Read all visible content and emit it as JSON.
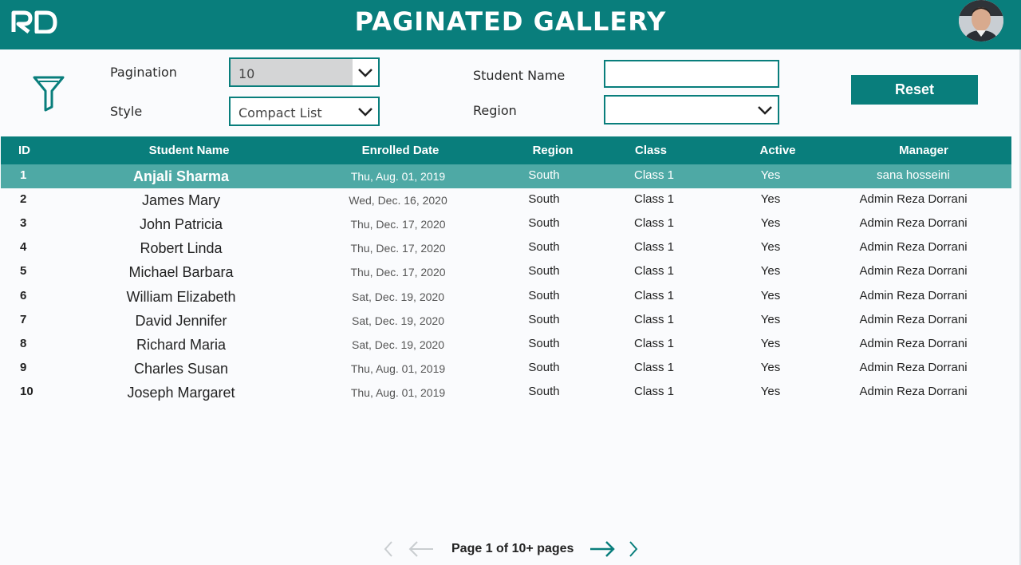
{
  "header": {
    "title": "PAGINATED GALLERY"
  },
  "filters": {
    "pagination_label": "Pagination",
    "pagination_value": "10",
    "style_label": "Style",
    "style_value": "Compact List",
    "student_name_label": "Student Name",
    "student_name_value": "",
    "region_label": "Region",
    "region_value": "",
    "reset_label": "Reset"
  },
  "table": {
    "columns": [
      "ID",
      "Student Name",
      "Enrolled Date",
      "Region",
      "Class",
      "Active",
      "Manager"
    ],
    "rows": [
      {
        "id": "1",
        "name": "Anjali Sharma",
        "date": "Thu, Aug. 01, 2019",
        "region": "South",
        "cls": "Class 1",
        "active": "Yes",
        "manager": "sana hosseini"
      },
      {
        "id": "2",
        "name": "James Mary",
        "date": "Wed, Dec. 16, 2020",
        "region": "South",
        "cls": "Class 1",
        "active": "Yes",
        "manager": "Admin Reza Dorrani"
      },
      {
        "id": "3",
        "name": "John Patricia",
        "date": "Thu, Dec. 17, 2020",
        "region": "South",
        "cls": "Class 1",
        "active": "Yes",
        "manager": "Admin Reza Dorrani"
      },
      {
        "id": "4",
        "name": "Robert Linda",
        "date": "Thu, Dec. 17, 2020",
        "region": "South",
        "cls": "Class 1",
        "active": "Yes",
        "manager": "Admin Reza Dorrani"
      },
      {
        "id": "5",
        "name": "Michael Barbara",
        "date": "Thu, Dec. 17, 2020",
        "region": "South",
        "cls": "Class 1",
        "active": "Yes",
        "manager": "Admin Reza Dorrani"
      },
      {
        "id": "6",
        "name": "William Elizabeth",
        "date": "Sat, Dec. 19, 2020",
        "region": "South",
        "cls": "Class 1",
        "active": "Yes",
        "manager": "Admin Reza Dorrani"
      },
      {
        "id": "7",
        "name": "David Jennifer",
        "date": "Sat, Dec. 19, 2020",
        "region": "South",
        "cls": "Class 1",
        "active": "Yes",
        "manager": "Admin Reza Dorrani"
      },
      {
        "id": "8",
        "name": "Richard Maria",
        "date": "Sat, Dec. 19, 2020",
        "region": "South",
        "cls": "Class 1",
        "active": "Yes",
        "manager": "Admin Reza Dorrani"
      },
      {
        "id": "9",
        "name": "Charles Susan",
        "date": "Thu, Aug. 01, 2019",
        "region": "South",
        "cls": "Class 1",
        "active": "Yes",
        "manager": "Admin Reza Dorrani"
      },
      {
        "id": "10",
        "name": "Joseph Margaret",
        "date": "Thu, Aug. 01, 2019",
        "region": "South",
        "cls": "Class 1",
        "active": "Yes",
        "manager": "Admin Reza Dorrani"
      }
    ]
  },
  "pager": {
    "text": "Page 1 of 10+ pages"
  },
  "icons": {
    "logo": "rd-logo",
    "filter": "filter-icon",
    "chevron": "chevron-down-icon",
    "first": "chevron-left-icon",
    "prev": "arrow-left-icon",
    "next": "arrow-right-icon",
    "last": "chevron-right-icon"
  },
  "colors": {
    "accent": "#097e7c",
    "selected_row": "#4ea9a5"
  }
}
